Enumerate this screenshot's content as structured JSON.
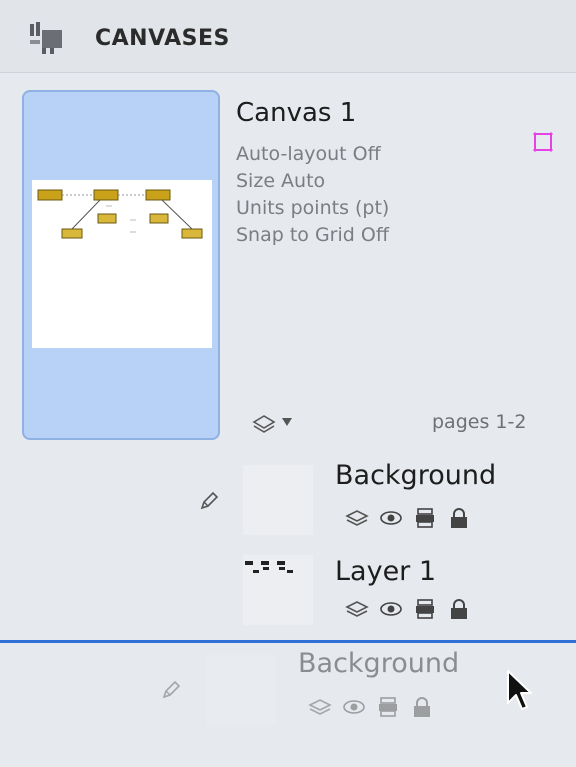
{
  "header": {
    "title": "CANVASES",
    "icon": "canvases-icon"
  },
  "canvas": {
    "name": "Canvas 1",
    "info": [
      "Auto-layout Off",
      "Size Auto",
      "Units points (pt)",
      "Snap to Grid Off"
    ],
    "pages": "pages 1-2",
    "selected": true,
    "accent": "#b7d1f7"
  },
  "layers": [
    {
      "name": "Background",
      "icons": [
        "layer-icon",
        "eye-icon",
        "print-icon",
        "lock-icon"
      ],
      "editable_pencil": true
    },
    {
      "name": "Layer 1",
      "icons": [
        "layer-icon",
        "eye-icon",
        "print-icon",
        "lock-icon"
      ],
      "editable_pencil": false
    }
  ],
  "drag_ghost": {
    "name": "Background",
    "icons": [
      "layer-icon",
      "eye-icon",
      "print-icon",
      "lock-icon"
    ]
  },
  "colors": {
    "drop_indicator": "#2f6fd6",
    "panel_bg": "#e6e9ee",
    "toggle_magenta": "#e542e5"
  }
}
